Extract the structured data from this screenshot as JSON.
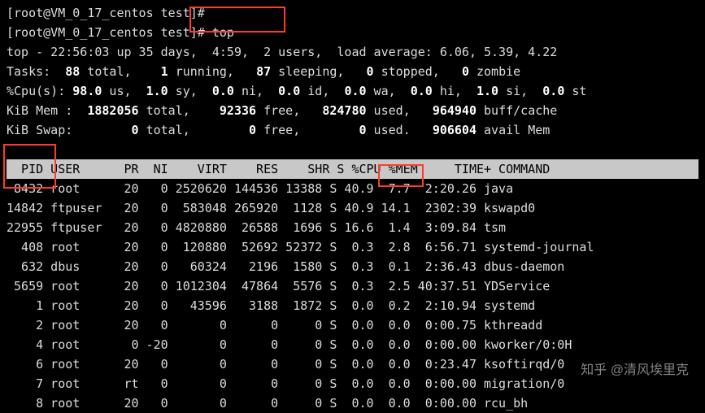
{
  "prompt1": "[root@VM_0_17_centos test]#",
  "prompt2": "[root@VM_0_17_centos test]# ",
  "command": "top",
  "summary": {
    "line": "top - 22:56:03 up 35 days,  4:59,  2 users,  load average: 6.06, 5.39, 4.22",
    "tasks_label": "Tasks:  ",
    "tasks_total": "88",
    "tasks_running": "1",
    "tasks_sleeping": "87",
    "tasks_stopped": "0",
    "tasks_zombie": "0",
    "cpu_label": "%Cpu(s): ",
    "cpu_us": "98.0",
    "cpu_sy": "1.0",
    "cpu_ni": "0.0",
    "cpu_id": "0.0",
    "cpu_wa": "0.0",
    "cpu_hi": "0.0",
    "cpu_si": "1.0",
    "cpu_st": "0.0",
    "mem_total": "1882056",
    "mem_free": "92336",
    "mem_used": "824780",
    "mem_buff": "964940",
    "swap_total": "0",
    "swap_free": "0",
    "swap_used": "0",
    "swap_avail": "906604"
  },
  "columns": "  PID USER      PR  NI    VIRT    RES    SHR S %CPU %MEM     TIME+ COMMAND         ",
  "processes": [
    {
      "pid": " 8432",
      "user": "root   ",
      "pr": "20",
      "ni": "  0",
      "virt": "2520620",
      "res": "144536",
      "shr": "13388",
      "s": "S",
      "cpu": "40.9",
      "mem": " 7.7",
      "time": " 2:20.26",
      "cmd": "java"
    },
    {
      "pid": "14842",
      "user": "ftpuser",
      "pr": "20",
      "ni": "  0",
      "virt": " 583048",
      "res": "265920",
      "shr": " 1128",
      "s": "S",
      "cpu": "40.9",
      "mem": "14.1",
      "time": " 2302:39",
      "cmd": "kswapd0"
    },
    {
      "pid": "22955",
      "user": "ftpuser",
      "pr": "20",
      "ni": "  0",
      "virt": "4820880",
      "res": " 26588",
      "shr": " 1696",
      "s": "S",
      "cpu": "16.6",
      "mem": " 1.4",
      "time": " 3:09.84",
      "cmd": "tsm"
    },
    {
      "pid": "  408",
      "user": "root   ",
      "pr": "20",
      "ni": "  0",
      "virt": " 120880",
      "res": " 52692",
      "shr": "52372",
      "s": "S",
      "cpu": " 0.3",
      "mem": " 2.8",
      "time": " 6:56.71",
      "cmd": "systemd-journal"
    },
    {
      "pid": "  632",
      "user": "dbus   ",
      "pr": "20",
      "ni": "  0",
      "virt": "  60324",
      "res": "  2196",
      "shr": " 1580",
      "s": "S",
      "cpu": " 0.3",
      "mem": " 0.1",
      "time": " 2:36.43",
      "cmd": "dbus-daemon"
    },
    {
      "pid": " 5659",
      "user": "root   ",
      "pr": "20",
      "ni": "  0",
      "virt": "1012304",
      "res": " 47864",
      "shr": " 5576",
      "s": "S",
      "cpu": " 0.3",
      "mem": " 2.5",
      "time": "40:37.51",
      "cmd": "YDService"
    },
    {
      "pid": "    1",
      "user": "root   ",
      "pr": "20",
      "ni": "  0",
      "virt": "  43596",
      "res": "  3188",
      "shr": " 1872",
      "s": "S",
      "cpu": " 0.0",
      "mem": " 0.2",
      "time": " 2:10.94",
      "cmd": "systemd"
    },
    {
      "pid": "    2",
      "user": "root   ",
      "pr": "20",
      "ni": "  0",
      "virt": "      0",
      "res": "     0",
      "shr": "    0",
      "s": "S",
      "cpu": " 0.0",
      "mem": " 0.0",
      "time": " 0:00.75",
      "cmd": "kthreadd"
    },
    {
      "pid": "    4",
      "user": "root   ",
      "pr": " 0",
      "ni": "-20",
      "virt": "      0",
      "res": "     0",
      "shr": "    0",
      "s": "S",
      "cpu": " 0.0",
      "mem": " 0.0",
      "time": " 0:00.00",
      "cmd": "kworker/0:0H"
    },
    {
      "pid": "    6",
      "user": "root   ",
      "pr": "20",
      "ni": "  0",
      "virt": "      0",
      "res": "     0",
      "shr": "    0",
      "s": "S",
      "cpu": " 0.0",
      "mem": " 0.0",
      "time": " 0:23.47",
      "cmd": "ksoftirqd/0"
    },
    {
      "pid": "    7",
      "user": "root   ",
      "pr": "rt",
      "ni": "  0",
      "virt": "      0",
      "res": "     0",
      "shr": "    0",
      "s": "S",
      "cpu": " 0.0",
      "mem": " 0.0",
      "time": " 0:00.00",
      "cmd": "migration/0"
    },
    {
      "pid": "    8",
      "user": "root   ",
      "pr": "20",
      "ni": "  0",
      "virt": "      0",
      "res": "     0",
      "shr": "    0",
      "s": "S",
      "cpu": " 0.0",
      "mem": " 0.0",
      "time": " 0:00.00",
      "cmd": "rcu_bh"
    }
  ],
  "watermark": "知乎 @清风埃里克"
}
